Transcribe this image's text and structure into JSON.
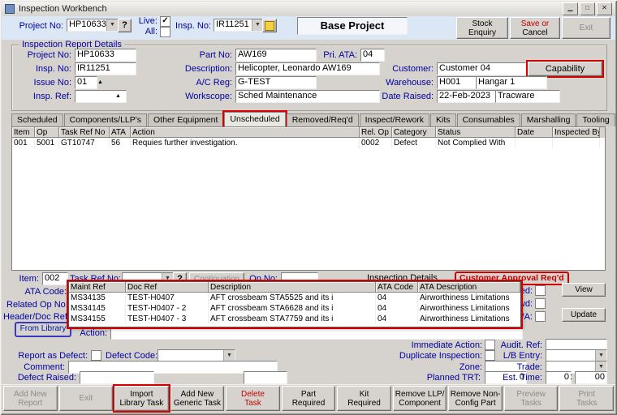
{
  "window": {
    "title": "Inspection Workbench",
    "minimize": "▁",
    "maximize": "□",
    "close": "✕"
  },
  "topbar": {
    "project_no_label": "Project No:",
    "project_no": "HP10633",
    "help": "?",
    "live_label": "Live:",
    "live_check": "✓",
    "all_label": "All:",
    "insp_no_label": "Insp. No:",
    "insp_no": "IR11251",
    "base_project": "Base Project",
    "stock_enquiry_1": "Stock",
    "stock_enquiry_2": "Enquiry",
    "save_1": "Save or",
    "save_2": "Cancel",
    "exit": "Exit"
  },
  "details": {
    "group_title": "Inspection Report Details",
    "project_no_label": "Project No:",
    "project_no": "HP10633",
    "part_no_label": "Part No:",
    "part_no": "AW169",
    "pri_ata_label": "Pri. ATA:",
    "pri_ata": "04",
    "insp_no_label": "Insp. No:",
    "insp_no": "IR11251",
    "description_label": "Description:",
    "description": "Helicopter, Leonardo AW169",
    "customer_label": "Customer:",
    "customer": "Customer 04",
    "capability": "Capability",
    "issue_no_label": "Issue No:",
    "issue_no": "01",
    "ac_reg_label": "A/C Reg:",
    "ac_reg": "G-TEST",
    "warehouse_label": "Warehouse:",
    "warehouse": "H001",
    "warehouse_name": "Hangar 1",
    "insp_ref_label": "Insp. Ref:",
    "workscope_label": "Workscope:",
    "workscope": "Sched Maintenance",
    "date_raised_label": "Date Raised:",
    "date_raised": "22-Feb-2023",
    "date_raised_src": "Tracware"
  },
  "tabs": [
    {
      "label": "Scheduled",
      "active": false,
      "highlight": false
    },
    {
      "label": "Components/LLP's",
      "active": false,
      "highlight": false
    },
    {
      "label": "Other Equipment",
      "active": false,
      "highlight": false
    },
    {
      "label": "Unscheduled",
      "active": true,
      "highlight": true
    },
    {
      "label": "Removed/Req'd",
      "active": false,
      "highlight": false
    },
    {
      "label": "Inspect/Rework",
      "active": false,
      "highlight": false
    },
    {
      "label": "Kits",
      "active": false,
      "highlight": false
    },
    {
      "label": "Consumables",
      "active": false,
      "highlight": false
    },
    {
      "label": "Marshalling",
      "active": false,
      "highlight": false
    },
    {
      "label": "Tooling",
      "active": false,
      "highlight": false
    }
  ],
  "grid": {
    "columns": [
      "Item",
      "Op",
      "Task Ref No",
      "ATA",
      "Action",
      "Rel. Op",
      "Category",
      "Status",
      "Date",
      "Inspected By"
    ],
    "rows": [
      [
        "001",
        "5001",
        "GT10747",
        "56",
        "Requies further investigation.",
        "0002",
        "Defect",
        "Not Complied With",
        "",
        ""
      ]
    ]
  },
  "form": {
    "item_label": "Item:",
    "item": "002",
    "task_ref_label": "Task Ref No:",
    "help": "?",
    "continuation": "Continuation",
    "op_no_label": "Op No:",
    "inspection_details": "Inspection Details",
    "customer_approval": "Customer Approval Req'd",
    "ata_code_label": "ATA Code:",
    "related_op_label": "Related Op No:",
    "header_doc_label": "Header/Doc Ref:",
    "from_library": "From Library",
    "action_label": "Action:",
    "actioned_frag": "oned:",
    "cfwd_frag": "d Fwd:",
    "na_frag": "N/A:",
    "view": "View",
    "update": "Update",
    "immediate_action_label": "Immediate Action:",
    "audit_ref_label": "Audit. Ref:",
    "report_as_defect_label": "Report as Defect:",
    "defect_code_label": "Defect Code:",
    "duplicate_inspection_label": "Duplicate Inspection:",
    "lb_entry_label": "L/B Entry:",
    "comment_label": "Comment:",
    "zone_label": "Zone:",
    "trade_label": "Trade:",
    "defect_raised_label": "Defect Raised:",
    "planned_trt_label": "Planned TRT:",
    "planned_trt": "0",
    "est_time_label": "Est. Time:",
    "est_time_h": "0",
    "est_time_sep": ":",
    "est_time_m": "00"
  },
  "popup": {
    "columns": [
      "Maint Ref",
      "Doc Ref",
      "Description",
      "ATA Code",
      "ATA Description"
    ],
    "rows": [
      [
        "MS34135",
        "TEST-H0407",
        "AFT crossbeam STA5525 and its i",
        "04",
        "Airworthiness Limitations"
      ],
      [
        "MS34145",
        "TEST-H0407 - 2",
        "AFT crossbeam STA6628 and its i",
        "04",
        "Airworthiness Limitations"
      ],
      [
        "MS34155",
        "TEST-H0407 - 3",
        "AFT crossbeam STA7759 and its i",
        "04",
        "Airworthiness Limitations"
      ]
    ]
  },
  "footer": [
    {
      "l1": "Add New",
      "l2": "Report",
      "disabled": true,
      "danger": false,
      "highlight": false
    },
    {
      "l1": "Exit",
      "l2": "",
      "disabled": true,
      "danger": false,
      "highlight": false
    },
    {
      "l1": "Import",
      "l2": "Library Task",
      "disabled": false,
      "danger": false,
      "highlight": true
    },
    {
      "l1": "Add New",
      "l2": "Generic Task",
      "disabled": false,
      "danger": false,
      "highlight": false
    },
    {
      "l1": "Delete",
      "l2": "Task",
      "disabled": false,
      "danger": true,
      "highlight": false
    },
    {
      "l1": "Part",
      "l2": "Required",
      "disabled": false,
      "danger": false,
      "highlight": false
    },
    {
      "l1": "Kit",
      "l2": "Required",
      "disabled": false,
      "danger": false,
      "highlight": false
    },
    {
      "l1": "Remove LLP/",
      "l2": "Component",
      "disabled": false,
      "danger": false,
      "highlight": false
    },
    {
      "l1": "Remove Non-",
      "l2": "Config Part",
      "disabled": false,
      "danger": false,
      "highlight": false
    },
    {
      "l1": "Preview",
      "l2": "Tasks",
      "disabled": true,
      "danger": false,
      "highlight": false
    },
    {
      "l1": "Print",
      "l2": "Tasks",
      "disabled": true,
      "danger": false,
      "highlight": false
    }
  ],
  "colors": {
    "label": "#0000a0",
    "annotation": "#d40000",
    "danger": "#c00000",
    "library_outline": "#3a3ac0"
  }
}
